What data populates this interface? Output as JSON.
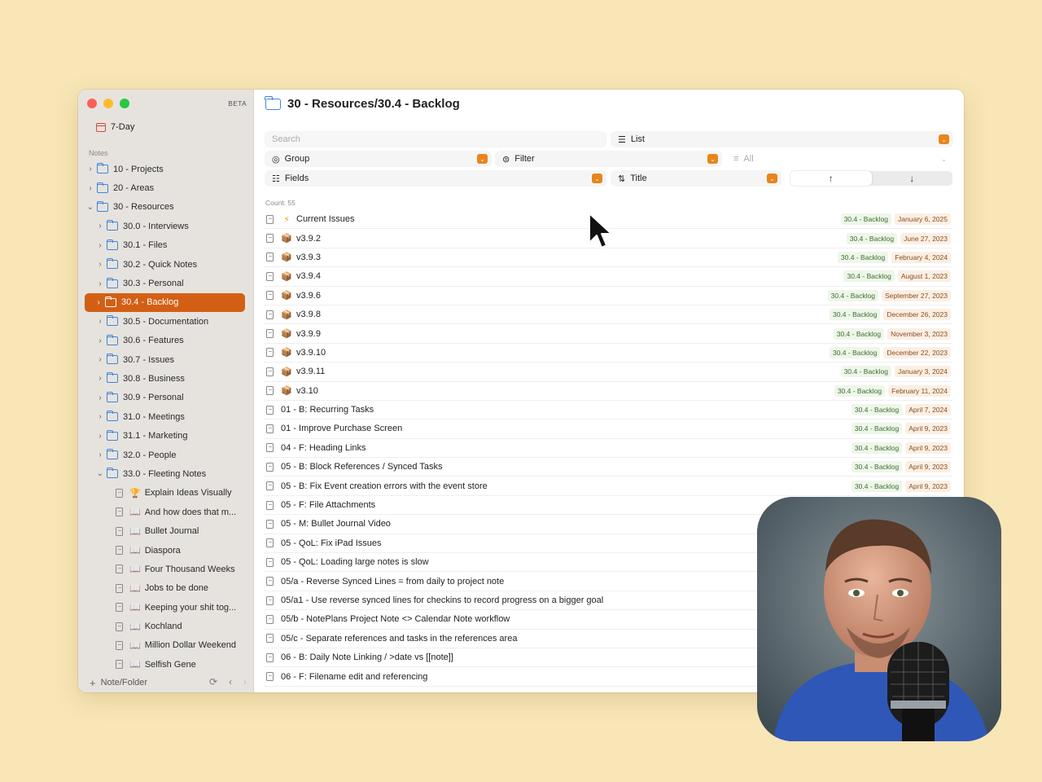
{
  "window": {
    "beta_label": "BETA",
    "seven_day": "7-Day",
    "section_label": "Notes",
    "footer_label": "Note/Folder"
  },
  "sidebar": {
    "folders": [
      {
        "label": "10 - Projects",
        "level": 0,
        "expanded": false
      },
      {
        "label": "20 - Areas",
        "level": 0,
        "expanded": false
      },
      {
        "label": "30 - Resources",
        "level": 0,
        "expanded": true
      },
      {
        "label": "30.0 - Interviews",
        "level": 1,
        "expanded": false
      },
      {
        "label": "30.1 - Files",
        "level": 1,
        "expanded": false
      },
      {
        "label": "30.2 - Quick Notes",
        "level": 1,
        "expanded": false
      },
      {
        "label": "30.3 - Personal",
        "level": 1,
        "expanded": false
      },
      {
        "label": "30.4 - Backlog",
        "level": 1,
        "expanded": false,
        "active": true
      },
      {
        "label": "30.5 - Documentation",
        "level": 1,
        "expanded": false
      },
      {
        "label": "30.6 - Features",
        "level": 1,
        "expanded": false
      },
      {
        "label": "30.7 - Issues",
        "level": 1,
        "expanded": false
      },
      {
        "label": "30.8 - Business",
        "level": 1,
        "expanded": false
      },
      {
        "label": "30.9 - Personal",
        "level": 1,
        "expanded": false
      },
      {
        "label": "31.0 - Meetings",
        "level": 1,
        "expanded": false
      },
      {
        "label": "31.1 - Marketing",
        "level": 1,
        "expanded": false
      },
      {
        "label": "32.0 - People",
        "level": 1,
        "expanded": false
      },
      {
        "label": "33.0 - Fleeting Notes",
        "level": 1,
        "expanded": true
      }
    ],
    "fleeting_notes": [
      {
        "label": "Explain Ideas Visually",
        "icon": "trophy-icon"
      },
      {
        "label": "And how does that m...",
        "icon": "book-icon"
      },
      {
        "label": "Bullet Journal",
        "icon": "book-icon"
      },
      {
        "label": "Diaspora",
        "icon": "book-icon"
      },
      {
        "label": "Four Thousand Weeks",
        "icon": "book-icon"
      },
      {
        "label": "Jobs to be done",
        "icon": "book-icon"
      },
      {
        "label": "Keeping your shit tog...",
        "icon": "book-icon"
      },
      {
        "label": "Kochland",
        "icon": "book-icon"
      },
      {
        "label": "Million Dollar Weekend",
        "icon": "book-icon"
      },
      {
        "label": "Selfish Gene",
        "icon": "book-icon"
      }
    ]
  },
  "main": {
    "title": "30 - Resources/30.4 - Backlog",
    "search_placeholder": "Search",
    "view_label": "List",
    "group_label": "Group",
    "filter_label": "Filter",
    "all_label": "All",
    "fields_label": "Fields",
    "sort_label": "Title",
    "sort_asc": "↑",
    "sort_desc": "↓",
    "count_label": "Count: 55"
  },
  "notes": [
    {
      "title": "Current Issues",
      "icon": "lightning-icon",
      "tag": "30.4 - Backlog",
      "date": "January 6, 2025"
    },
    {
      "title": "v3.9.2",
      "icon": "package-icon",
      "tag": "30.4 - Backlog",
      "date": "June 27, 2023"
    },
    {
      "title": "v3.9.3",
      "icon": "package-icon",
      "tag": "30.4 - Backlog",
      "date": "February 4, 2024"
    },
    {
      "title": "v3.9.4",
      "icon": "package-icon",
      "tag": "30.4 - Backlog",
      "date": "August 1, 2023"
    },
    {
      "title": "v3.9.6",
      "icon": "package-icon",
      "tag": "30.4 - Backlog",
      "date": "September 27, 2023"
    },
    {
      "title": "v3.9.8",
      "icon": "package-icon",
      "tag": "30.4 - Backlog",
      "date": "December 26, 2023"
    },
    {
      "title": "v3.9.9",
      "icon": "package-icon",
      "tag": "30.4 - Backlog",
      "date": "November 3, 2023"
    },
    {
      "title": "v3.9.10",
      "icon": "package-icon",
      "tag": "30.4 - Backlog",
      "date": "December 22, 2023"
    },
    {
      "title": "v3.9.11",
      "icon": "package-icon",
      "tag": "30.4 - Backlog",
      "date": "January 3, 2024"
    },
    {
      "title": "v3.10",
      "icon": "package-icon",
      "tag": "30.4 - Backlog",
      "date": "February 11, 2024"
    },
    {
      "title": "01 - B: Recurring Tasks",
      "icon": "",
      "tag": "30.4 - Backlog",
      "date": "April 7, 2024"
    },
    {
      "title": "01 - Improve Purchase Screen",
      "icon": "",
      "tag": "30.4 - Backlog",
      "date": "April 9, 2023"
    },
    {
      "title": "04 - F: Heading Links",
      "icon": "",
      "tag": "30.4 - Backlog",
      "date": "April 9, 2023"
    },
    {
      "title": "05 - B: Block References / Synced Tasks",
      "icon": "",
      "tag": "30.4 - Backlog",
      "date": "April 9, 2023"
    },
    {
      "title": "05 - B: Fix Event creation errors with the event store",
      "icon": "",
      "tag": "30.4 - Backlog",
      "date": "April 9, 2023"
    },
    {
      "title": "05 - F: File Attachments",
      "icon": "",
      "tag": "",
      "date": ""
    },
    {
      "title": "05 - M: Bullet Journal Video",
      "icon": "",
      "tag": "",
      "date": ""
    },
    {
      "title": "05 - QoL: Fix iPad Issues",
      "icon": "",
      "tag": "",
      "date": ""
    },
    {
      "title": "05 - QoL: Loading large notes is slow",
      "icon": "",
      "tag": "",
      "date": ""
    },
    {
      "title": "05/a - Reverse Synced Lines = from daily to project note",
      "icon": "",
      "tag": "",
      "date": ""
    },
    {
      "title": "05/a1 - Use reverse synced lines for checkins to record progress on a bigger goal",
      "icon": "",
      "tag": "",
      "date": ""
    },
    {
      "title": "05/b - NotePlans Project Note <> Calendar Note workflow",
      "icon": "",
      "tag": "",
      "date": ""
    },
    {
      "title": "05/c - Separate references and tasks in the references area",
      "icon": "",
      "tag": "",
      "date": ""
    },
    {
      "title": "06 - B: Daily Note Linking / >date vs [[note]]",
      "icon": "",
      "tag": "",
      "date": ""
    },
    {
      "title": "06 - F: Filename edit and referencing",
      "icon": "",
      "tag": "",
      "date": ""
    }
  ],
  "colors": {
    "accent": "#d35f14",
    "folder": "#3f86d6",
    "background": "#f8e6b6"
  }
}
